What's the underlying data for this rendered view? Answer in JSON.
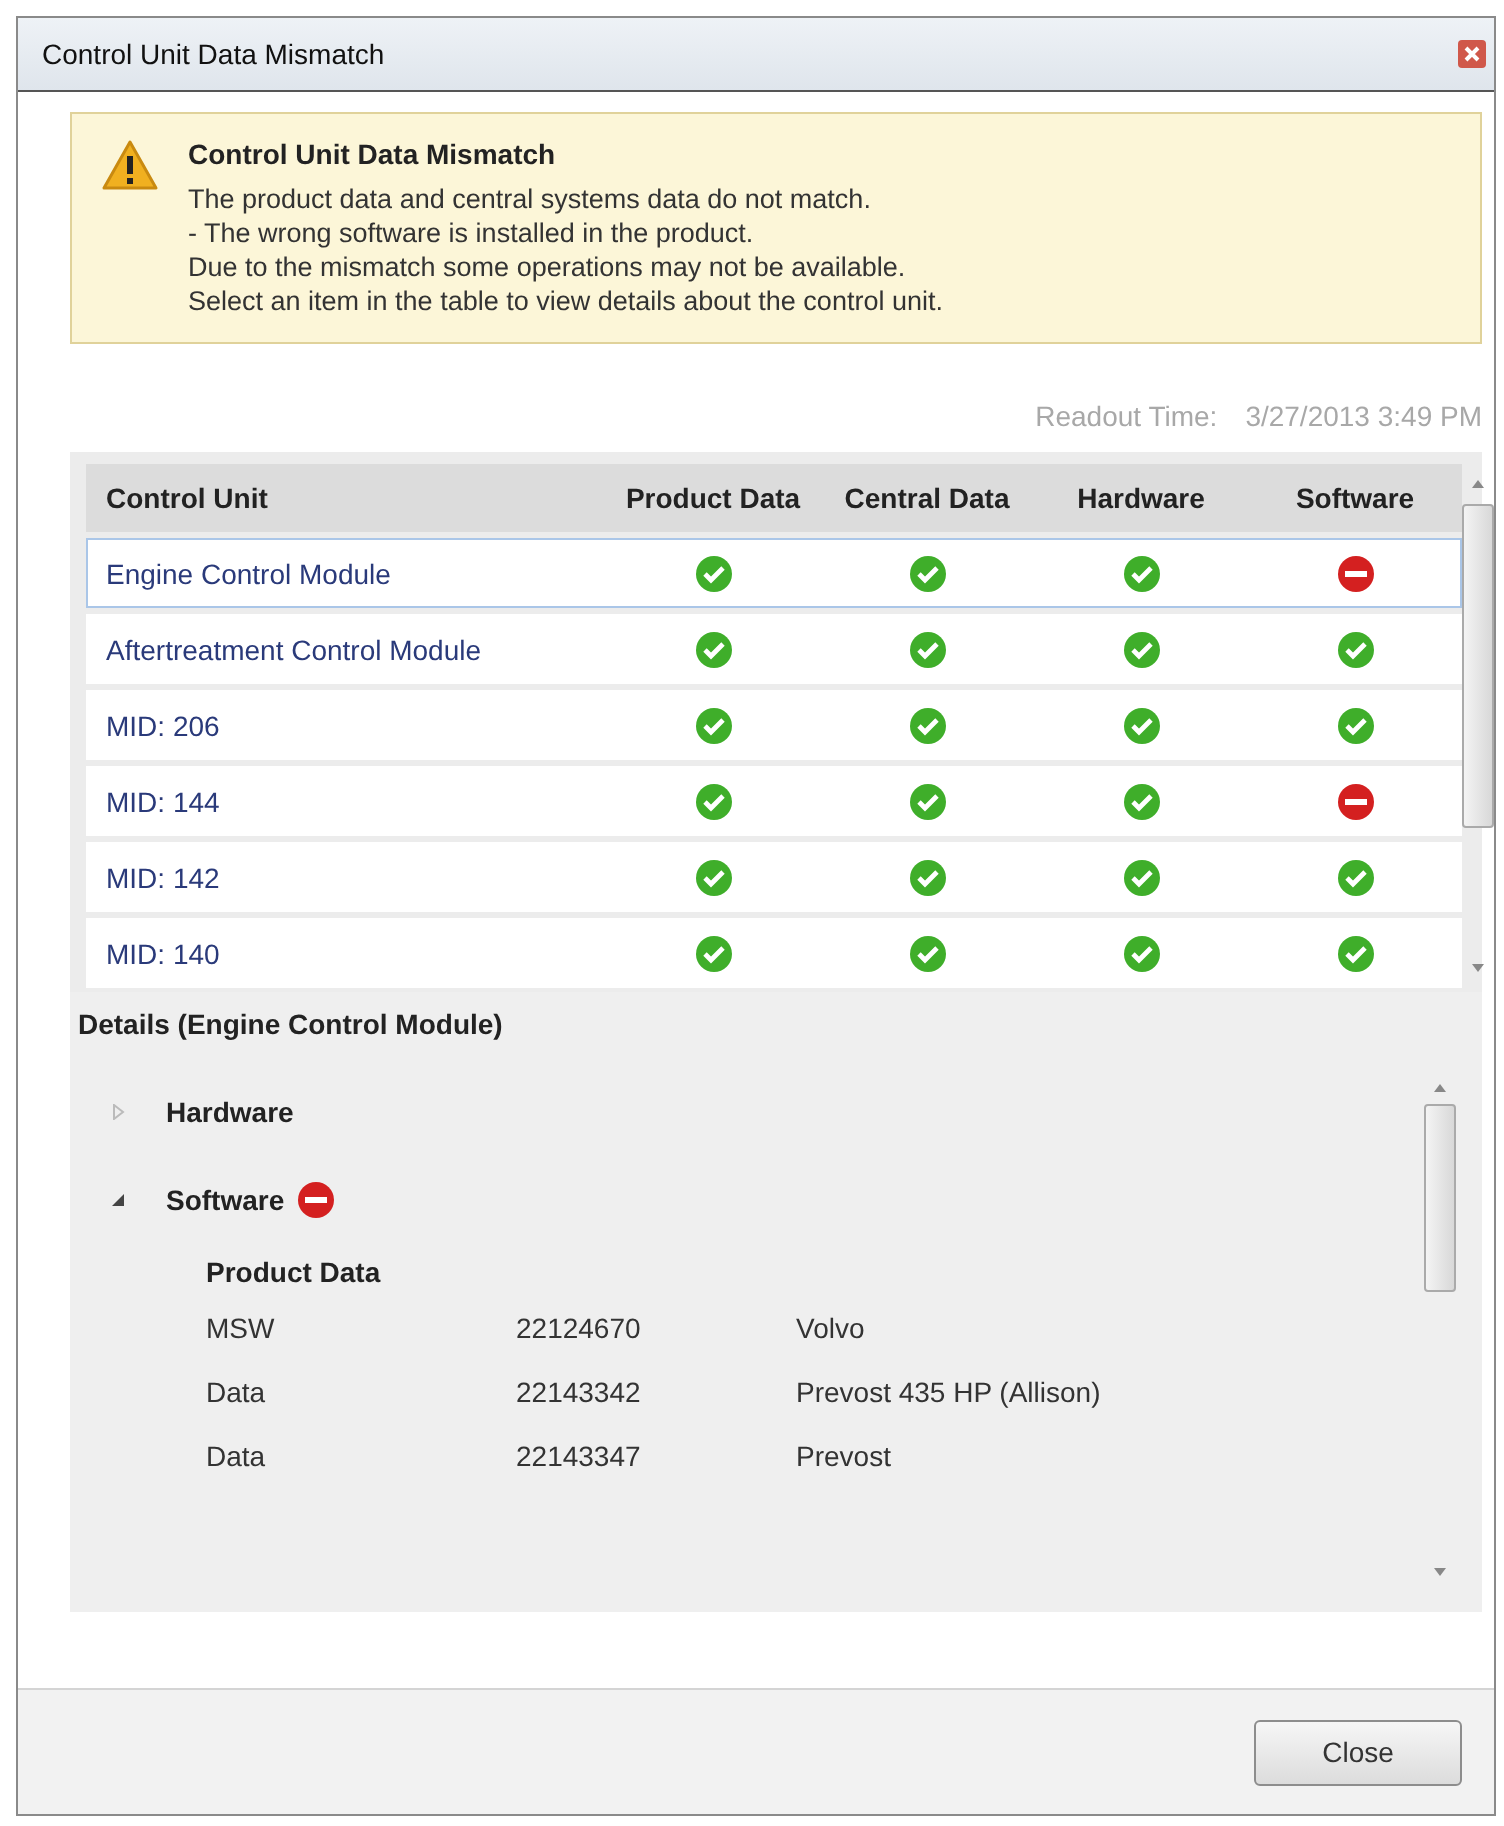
{
  "window": {
    "title": "Control Unit Data Mismatch"
  },
  "warning": {
    "title": "Control Unit Data Mismatch",
    "lines": [
      "The product data and central systems data do not match.",
      "- The wrong software is installed in the product.",
      "Due to the mismatch some operations may not be available.",
      "Select an item in the table to view details about the control unit."
    ]
  },
  "readout": {
    "label": "Readout Time:",
    "value": "3/27/2013 3:49 PM"
  },
  "table": {
    "columns": [
      "Control Unit",
      "Product Data",
      "Central Data",
      "Hardware",
      "Software"
    ],
    "rows": [
      {
        "name": "Engine Control Module",
        "selected": true,
        "checks": [
          {
            "match": true
          },
          {
            "match": true
          },
          {
            "match": true
          },
          {
            "match": false
          }
        ]
      },
      {
        "name": "Aftertreatment Control Module",
        "selected": false,
        "checks": [
          {
            "match": true
          },
          {
            "match": true
          },
          {
            "match": true
          },
          {
            "match": true
          }
        ]
      },
      {
        "name": "MID: 206",
        "selected": false,
        "checks": [
          {
            "match": true
          },
          {
            "match": true
          },
          {
            "match": true
          },
          {
            "match": true
          }
        ]
      },
      {
        "name": "MID: 144",
        "selected": false,
        "checks": [
          {
            "match": true
          },
          {
            "match": true
          },
          {
            "match": true
          },
          {
            "match": false
          }
        ]
      },
      {
        "name": "MID: 142",
        "selected": false,
        "checks": [
          {
            "match": true
          },
          {
            "match": true
          },
          {
            "match": true
          },
          {
            "match": true
          }
        ]
      },
      {
        "name": "MID: 140",
        "selected": false,
        "checks": [
          {
            "match": true
          },
          {
            "match": true
          },
          {
            "match": true
          },
          {
            "match": true
          }
        ]
      }
    ]
  },
  "details": {
    "title": "Details (Engine Control Module)",
    "nodes": [
      {
        "label": "Hardware",
        "expanded": false,
        "mismatch": false
      },
      {
        "label": "Software",
        "expanded": true,
        "mismatch": true,
        "section": "Product Data",
        "rows": [
          {
            "type": "MSW",
            "number": "22124670",
            "description": "Volvo"
          },
          {
            "type": "Data",
            "number": "22143342",
            "description": "Prevost 435 HP (Allison)"
          },
          {
            "type": "Data",
            "number": "22143347",
            "description": "Prevost"
          }
        ]
      }
    ]
  },
  "buttons": [
    "Close"
  ]
}
